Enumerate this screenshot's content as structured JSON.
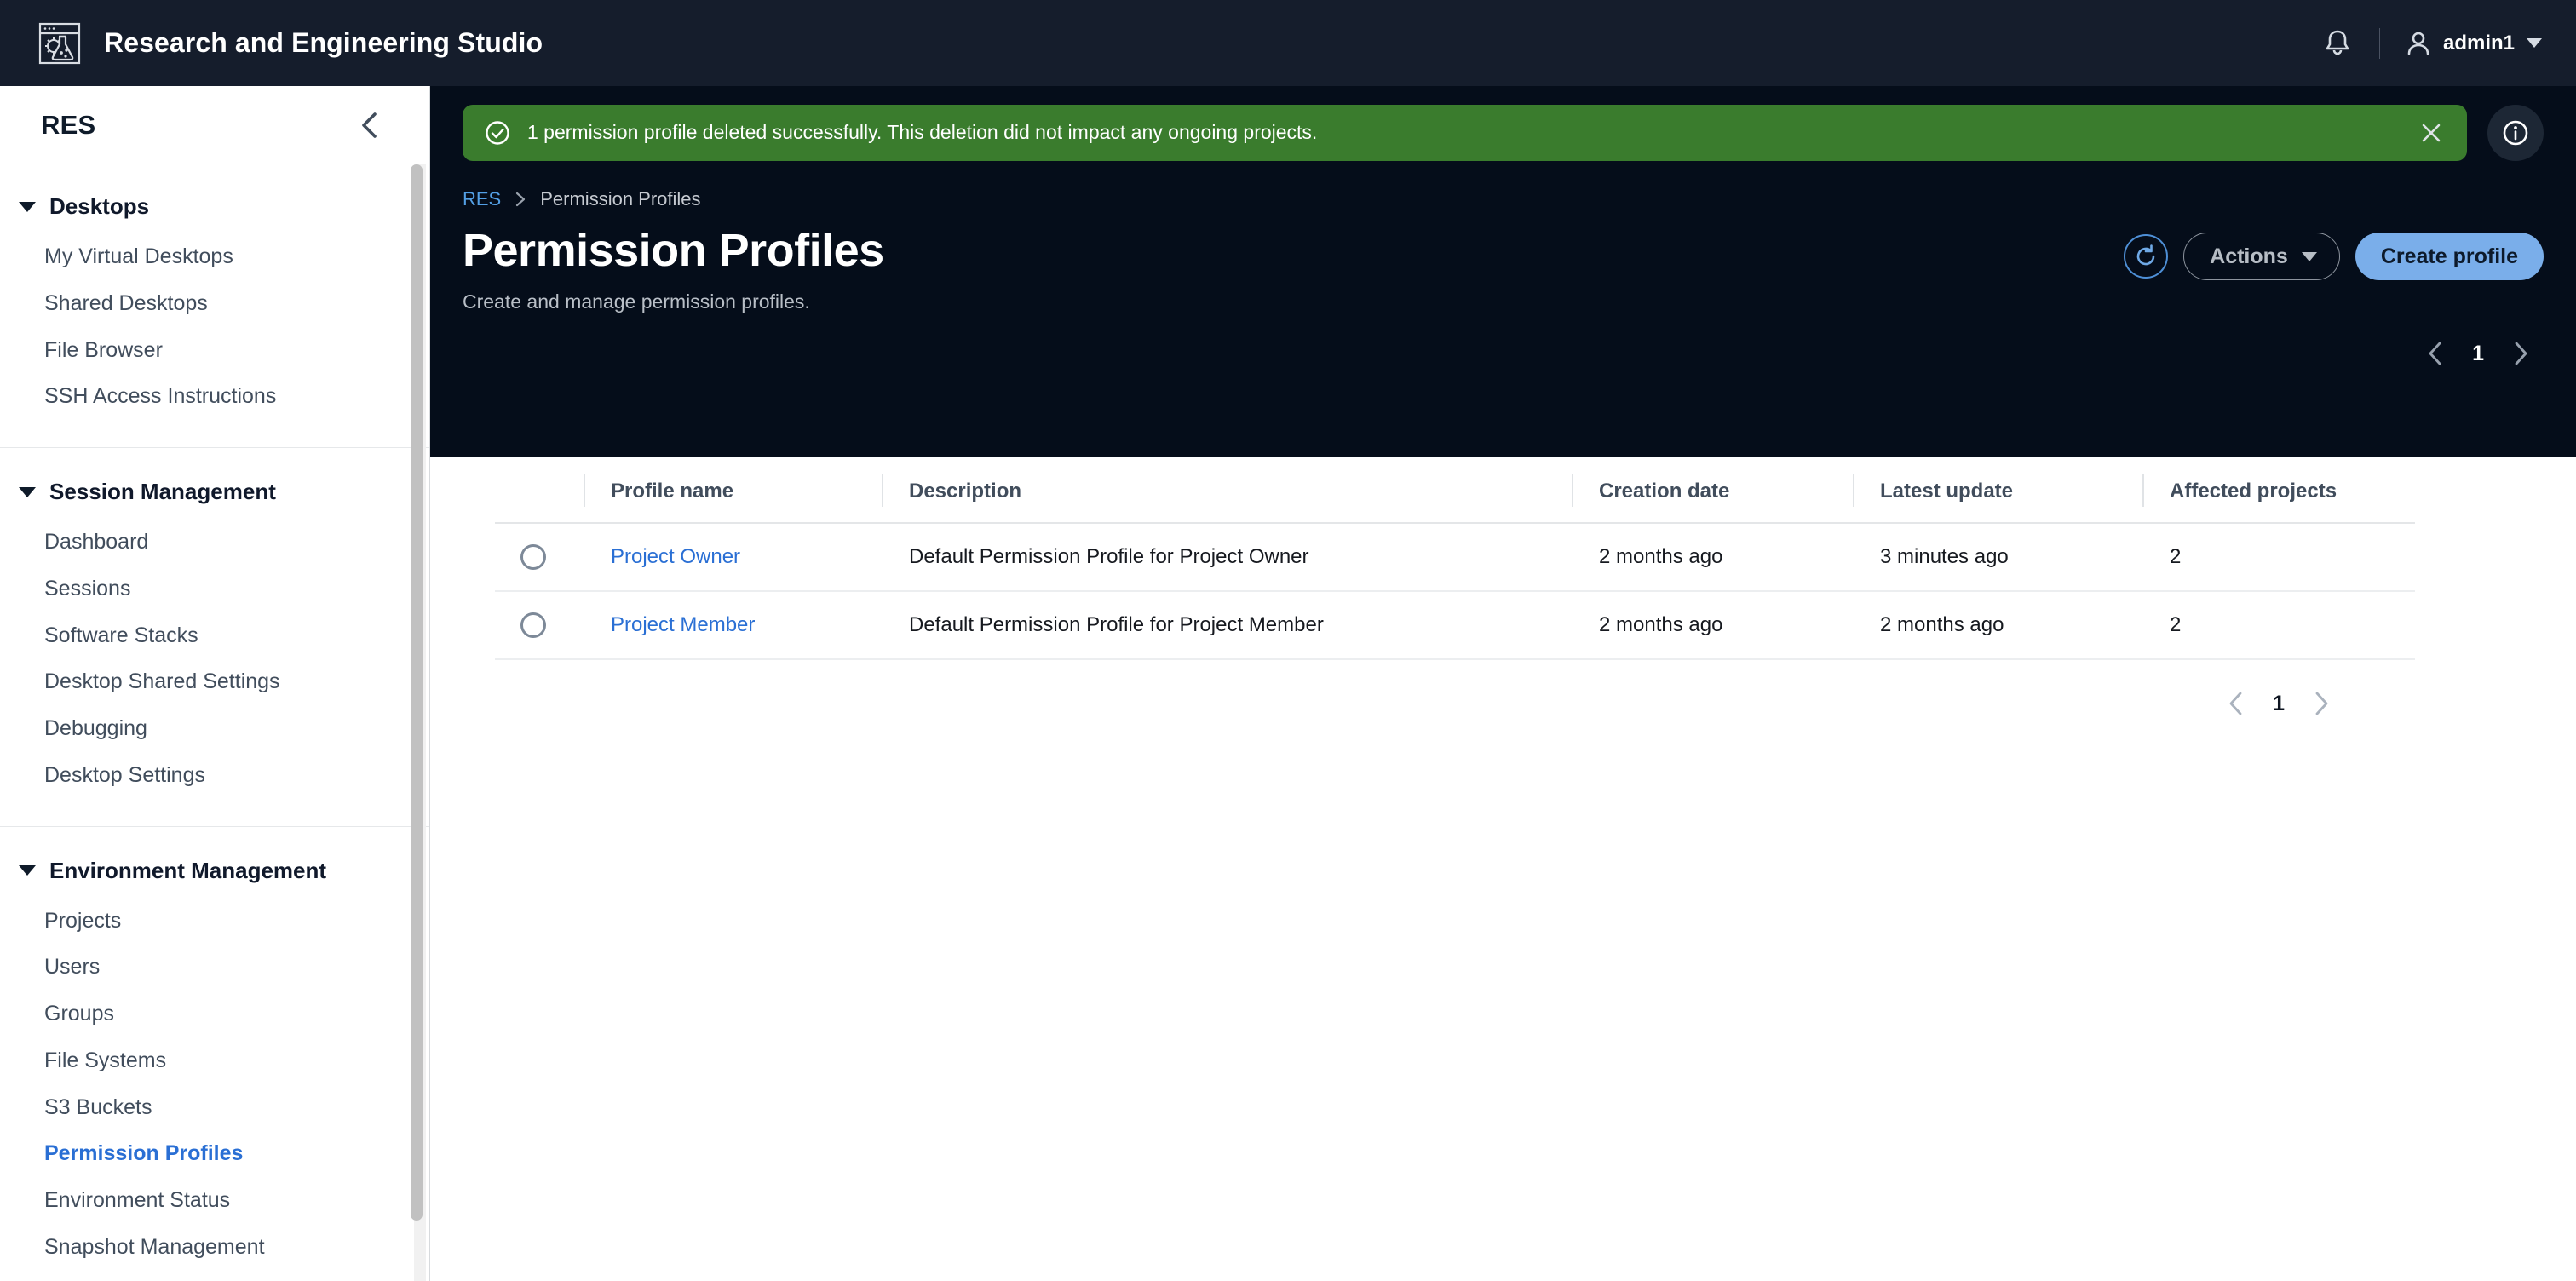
{
  "topbar": {
    "brand_title": "Research and Engineering Studio",
    "logo_icon": "flask-gear-browser-logo-icon",
    "notifications_icon": "bell-icon",
    "user_icon": "person-icon",
    "user_name": "admin1",
    "user_caret_icon": "caret-down-icon"
  },
  "sidebar": {
    "title": "RES",
    "collapse_icon": "chevron-left-icon",
    "groups": [
      {
        "label": "Desktops",
        "expanded": true,
        "items": [
          {
            "label": "My Virtual Desktops",
            "active": false
          },
          {
            "label": "Shared Desktops",
            "active": false
          },
          {
            "label": "File Browser",
            "active": false
          },
          {
            "label": "SSH Access Instructions",
            "active": false
          }
        ]
      },
      {
        "label": "Session Management",
        "expanded": true,
        "items": [
          {
            "label": "Dashboard",
            "active": false
          },
          {
            "label": "Sessions",
            "active": false
          },
          {
            "label": "Software Stacks",
            "active": false
          },
          {
            "label": "Desktop Shared Settings",
            "active": false
          },
          {
            "label": "Debugging",
            "active": false
          },
          {
            "label": "Desktop Settings",
            "active": false
          }
        ]
      },
      {
        "label": "Environment Management",
        "expanded": true,
        "items": [
          {
            "label": "Projects",
            "active": false
          },
          {
            "label": "Users",
            "active": false
          },
          {
            "label": "Groups",
            "active": false
          },
          {
            "label": "File Systems",
            "active": false
          },
          {
            "label": "S3 Buckets",
            "active": false
          },
          {
            "label": "Permission Profiles",
            "active": true
          },
          {
            "label": "Environment Status",
            "active": false
          },
          {
            "label": "Snapshot Management",
            "active": false
          }
        ]
      }
    ]
  },
  "flash": {
    "icon": "check-circle-icon",
    "message": "1 permission profile deleted successfully. This deletion did not impact any ongoing projects.",
    "close_icon": "close-icon",
    "background_color": "#3a7c2d"
  },
  "info_button": {
    "icon": "info-circle-icon"
  },
  "breadcrumb": {
    "root": "RES",
    "separator_icon": "chevron-right-icon",
    "current": "Permission Profiles"
  },
  "header": {
    "title": "Permission Profiles",
    "subtitle": "Create and manage permission profiles.",
    "refresh_icon": "refresh-icon",
    "actions_label": "Actions",
    "actions_caret_icon": "caret-down-icon",
    "create_label": "Create profile",
    "create_color": "#7aaeea"
  },
  "pagination_top": {
    "prev_icon": "chevron-left-icon",
    "page": "1",
    "next_icon": "chevron-right-icon"
  },
  "pagination_bottom": {
    "prev_icon": "chevron-left-icon",
    "page": "1",
    "next_icon": "chevron-right-icon"
  },
  "table": {
    "columns": [
      "Profile name",
      "Description",
      "Creation date",
      "Latest update",
      "Affected projects"
    ],
    "rows": [
      {
        "selected": false,
        "name": "Project Owner",
        "description": "Default Permission Profile for Project Owner",
        "creation_date": "2 months ago",
        "latest_update": "3 minutes ago",
        "affected_projects": "2"
      },
      {
        "selected": false,
        "name": "Project Member",
        "description": "Default Permission Profile for Project Member",
        "creation_date": "2 months ago",
        "latest_update": "2 months ago",
        "affected_projects": "2"
      }
    ]
  }
}
